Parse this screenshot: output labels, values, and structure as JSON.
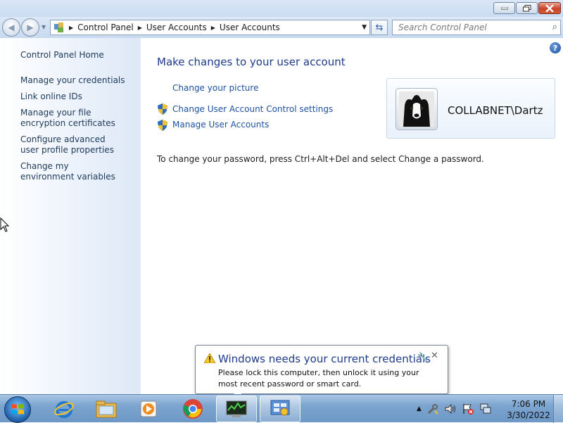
{
  "window": {
    "minimize_icon": "minimize-icon",
    "maximize_icon": "restore-icon",
    "close_icon": "close-icon"
  },
  "navigation": {
    "breadcrumbs": [
      "Control Panel",
      "User Accounts",
      "User Accounts"
    ],
    "search_placeholder": "Search Control Panel"
  },
  "sidebar": {
    "items": [
      {
        "label": "Control Panel Home"
      },
      {
        "label": "Manage your credentials"
      },
      {
        "label": "Link online IDs"
      },
      {
        "label": "Manage your file encryption certificates"
      },
      {
        "label": "Configure advanced user profile properties"
      },
      {
        "label": "Change my environment variables"
      }
    ]
  },
  "main": {
    "heading": "Make changes to your user account",
    "tasks": [
      {
        "label": "Change your picture",
        "icon": ""
      },
      {
        "label": "Change User Account Control settings",
        "icon": "uac-shield-icon"
      },
      {
        "label": "Manage User Accounts",
        "icon": "uac-shield-icon"
      }
    ],
    "password_note": "To change your password, press Ctrl+Alt+Del and select Change a password.",
    "user": {
      "name": "COLLABNET\\Dartz"
    }
  },
  "notification": {
    "title": "Windows needs your current credentials",
    "body": "Please lock this computer, then unlock it using your most recent password or smart card."
  },
  "taskbar": {
    "apps": [
      "internet-explorer-icon",
      "file-explorer-icon",
      "media-player-icon",
      "chrome-icon",
      "performance-monitor-icon",
      "control-panel-icon"
    ],
    "clock_time": "7:06 PM",
    "clock_date": "3/30/2022"
  }
}
